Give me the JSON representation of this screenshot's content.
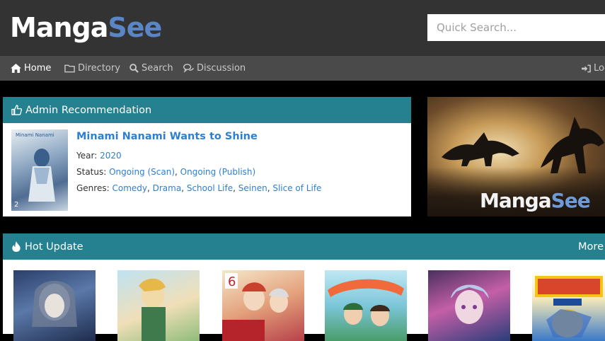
{
  "header": {
    "logo_part1": "Manga",
    "logo_part2": "See",
    "search_placeholder": "Quick Search..."
  },
  "nav": {
    "items": [
      {
        "label": "Home",
        "icon": "home-icon"
      },
      {
        "label": "Directory",
        "icon": "folder-icon"
      },
      {
        "label": "Search",
        "icon": "search-icon"
      },
      {
        "label": "Discussion",
        "icon": "comments-icon"
      }
    ],
    "login_label": "Log"
  },
  "recommendation": {
    "heading": "Admin Recommendation",
    "title": "Minami Nanami Wants to Shine",
    "year_label": "Year:",
    "year": "2020",
    "status_label": "Status:",
    "status_scan": "Ongoing (Scan)",
    "status_publish": "Ongoing (Publish)",
    "genres_label": "Genres:",
    "genres": [
      "Comedy",
      "Drama",
      "School Life",
      "Seinen",
      "Slice of Life"
    ],
    "cover_title": "Minami Nanami",
    "cover_number": "2"
  },
  "banner": {
    "text_part1": "Manga",
    "text_part2": "See"
  },
  "hot_update": {
    "heading": "Hot Update",
    "more_label": "More"
  },
  "colors": {
    "accent": "#25808f",
    "link": "#2f7fd1",
    "logo_blue": "#5b86c5"
  }
}
